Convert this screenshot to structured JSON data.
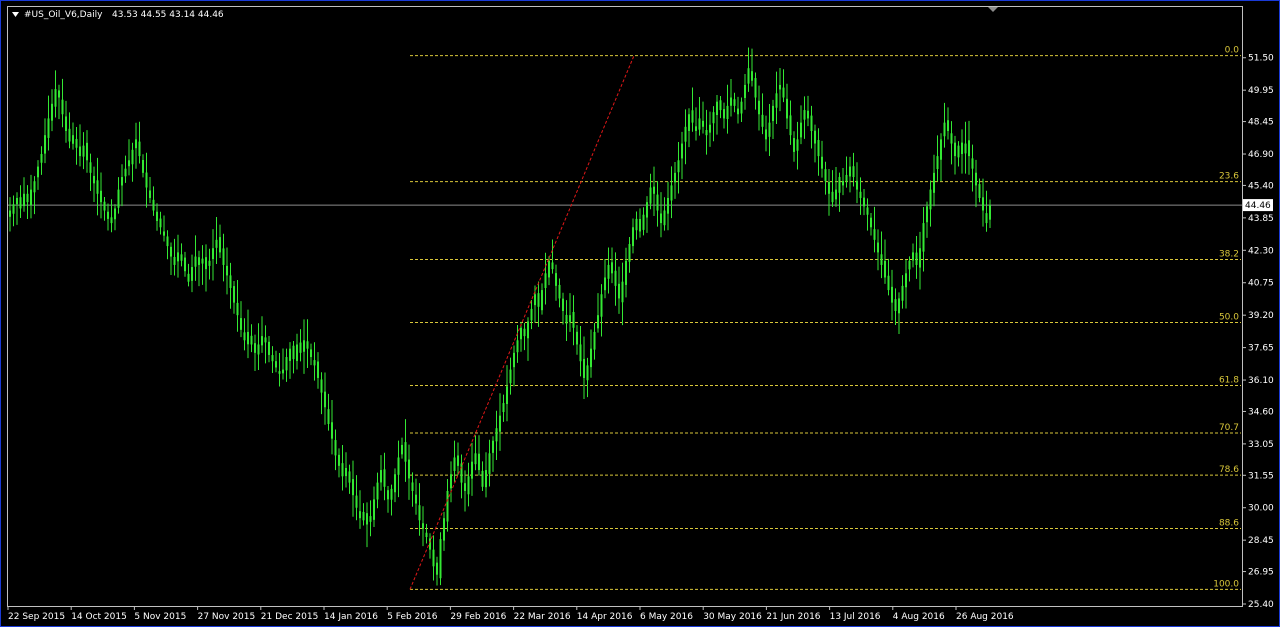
{
  "window": {
    "title": "#US_Oil_V6,Daily",
    "ohlc": "43.53 44.55 43.14 44.46"
  },
  "colors": {
    "background": "#000000",
    "window_border": "#1a3ad6",
    "candle": "#33e833",
    "axis": "#c0c0c0",
    "fib_line": "#d8c63a",
    "trend_line": "#e01818",
    "price_line": "#8c8c8c",
    "price_label_bg": "#ffffff",
    "price_label_fg": "#000000"
  },
  "chart_data": {
    "type": "candlestick",
    "symbol": "#US_Oil_V6",
    "timeframe": "Daily",
    "current_price": "44.46",
    "ylim": [
      25.4,
      52.3
    ],
    "y_ticks": [
      "51.50",
      "49.95",
      "48.45",
      "46.90",
      "45.40",
      "43.85",
      "42.30",
      "40.75",
      "39.20",
      "37.65",
      "36.10",
      "34.60",
      "33.05",
      "31.55",
      "30.00",
      "28.45",
      "26.95",
      "25.40"
    ],
    "x_ticks": [
      "22 Sep 2015",
      "14 Oct 2015",
      "5 Nov 2015",
      "27 Nov 2015",
      "21 Dec 2015",
      "14 Jan 2016",
      "5 Feb 2016",
      "29 Feb 2016",
      "22 Mar 2016",
      "14 Apr 2016",
      "6 May 2016",
      "30 May 2016",
      "21 Jun 2016",
      "13 Jul 2016",
      "4 Aug 2016",
      "26 Aug 2016"
    ],
    "fibonacci": {
      "high": 51.6,
      "low": 26.1,
      "levels": [
        {
          "label": "0.0",
          "ratio": 0.0
        },
        {
          "label": "23.6",
          "ratio": 0.236
        },
        {
          "label": "38.2",
          "ratio": 0.382
        },
        {
          "label": "50.0",
          "ratio": 0.5
        },
        {
          "label": "61.8",
          "ratio": 0.618
        },
        {
          "label": "70.7",
          "ratio": 0.707
        },
        {
          "label": "78.6",
          "ratio": 0.786
        },
        {
          "label": "88.6",
          "ratio": 0.886
        },
        {
          "label": "100.0",
          "ratio": 1.0
        }
      ]
    },
    "closes": [
      44.2,
      44.5,
      44.8,
      44.3,
      45.0,
      44.6,
      45.2,
      45.6,
      46.3,
      46.9,
      47.8,
      48.6,
      49.3,
      50.0,
      49.6,
      48.8,
      48.0,
      47.5,
      47.8,
      47.2,
      46.8,
      47.3,
      46.6,
      46.0,
      45.5,
      45.0,
      44.6,
      44.2,
      43.8,
      43.6,
      44.3,
      45.2,
      45.8,
      46.2,
      46.6,
      47.1,
      47.6,
      46.8,
      46.0,
      45.3,
      44.8,
      44.2,
      43.7,
      43.4,
      43.0,
      42.5,
      42.0,
      41.6,
      42.2,
      41.8,
      41.3,
      40.8,
      41.5,
      42.0,
      41.6,
      41.9,
      41.4,
      41.8,
      42.4,
      42.8,
      42.2,
      41.6,
      41.1,
      40.5,
      39.8,
      39.2,
      38.5,
      38.0,
      38.4,
      37.8,
      37.4,
      37.8,
      38.2,
      37.9,
      37.3,
      37.0,
      36.7,
      36.4,
      36.6,
      37.2,
      37.6,
      37.1,
      37.8,
      37.4,
      38.0,
      37.6,
      37.2,
      36.8,
      36.2,
      35.5,
      34.8,
      34.0,
      33.3,
      32.5,
      32.0,
      31.5,
      31.9,
      31.2,
      30.6,
      30.0,
      29.5,
      29.8,
      29.2,
      29.6,
      30.4,
      31.2,
      31.8,
      31.0,
      30.4,
      30.9,
      31.6,
      32.4,
      33.0,
      32.2,
      31.4,
      30.8,
      30.2,
      29.4,
      29.0,
      28.6,
      28.0,
      27.2,
      26.8,
      28.5,
      29.5,
      30.8,
      31.6,
      32.4,
      32.0,
      31.2,
      30.8,
      31.5,
      32.2,
      32.6,
      31.8,
      31.0,
      31.8,
      32.6,
      33.2,
      33.8,
      34.4,
      35.0,
      35.8,
      36.6,
      37.4,
      38.0,
      38.6,
      38.2,
      38.9,
      39.5,
      40.2,
      39.6,
      40.4,
      41.2,
      41.8,
      41.4,
      40.6,
      40.0,
      39.4,
      38.8,
      39.2,
      38.6,
      37.8,
      37.0,
      36.2,
      36.8,
      37.6,
      38.4,
      39.2,
      40.2,
      41.0,
      41.6,
      41.2,
      40.6,
      40.0,
      40.8,
      41.8,
      42.6,
      43.4,
      43.8,
      43.2,
      44.0,
      44.6,
      45.3,
      45.0,
      44.2,
      43.6,
      44.2,
      44.8,
      45.4,
      46.0,
      46.6,
      47.4,
      48.2,
      48.8,
      48.4,
      48.0,
      48.6,
      48.2,
      47.8,
      48.3,
      48.9,
      49.4,
      49.0,
      48.6,
      49.2,
      49.6,
      49.2,
      48.8,
      49.4,
      50.2,
      51.0,
      50.4,
      49.6,
      48.8,
      48.2,
      47.6,
      48.4,
      49.2,
      49.8,
      50.2,
      49.6,
      48.6,
      47.8,
      47.0,
      47.6,
      48.4,
      49.0,
      48.6,
      48.0,
      47.4,
      46.8,
      46.2,
      45.6,
      45.0,
      44.6,
      45.2,
      45.8,
      45.4,
      45.9,
      46.3,
      45.8,
      45.2,
      44.8,
      44.4,
      44.0,
      43.4,
      42.8,
      42.2,
      41.6,
      41.0,
      40.4,
      39.8,
      39.4,
      40.0,
      40.6,
      41.2,
      41.8,
      42.2,
      41.6,
      42.4,
      43.6,
      44.4,
      45.2,
      46.0,
      46.8,
      47.6,
      48.4,
      48.0,
      47.4,
      46.8,
      47.3,
      46.9,
      47.4,
      46.8,
      46.2,
      45.4,
      44.8,
      44.2,
      43.6,
      44.46
    ]
  }
}
